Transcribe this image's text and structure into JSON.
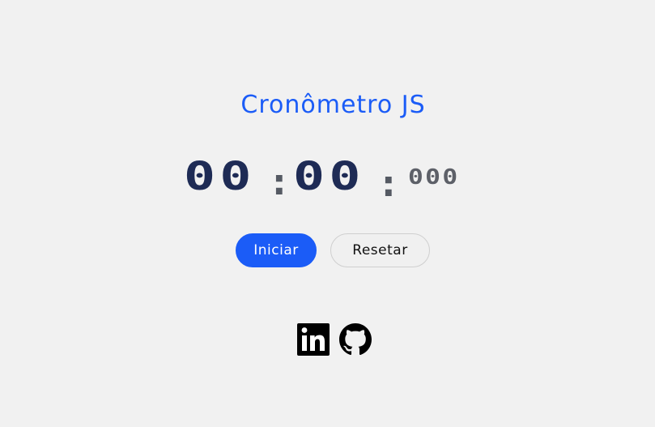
{
  "app": {
    "title": "Cronômetro JS"
  },
  "timer": {
    "minutes": "00",
    "separator1": ":",
    "seconds": "00",
    "separator2": ":",
    "milliseconds": "000"
  },
  "controls": {
    "start_label": "Iniciar",
    "reset_label": "Resetar"
  },
  "social": {
    "links": [
      {
        "icon": "linkedin-icon"
      },
      {
        "icon": "github-icon"
      }
    ]
  },
  "colors": {
    "accent": "#1b5cf7",
    "digits": "#1e2b55",
    "muted": "#5d6068",
    "background": "#f1f1f1"
  }
}
